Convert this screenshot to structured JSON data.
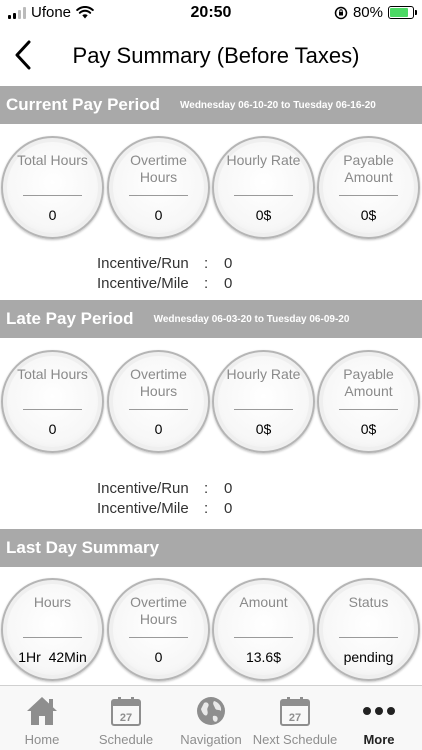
{
  "status_bar": {
    "carrier": "Ufone",
    "time": "20:50",
    "battery": "80%",
    "battery_level": 0.8
  },
  "header": {
    "title": "Pay Summary (Before Taxes)"
  },
  "current_period": {
    "title": "Current Pay Period",
    "dates": "Wednesday 06-10-20 to Tuesday 06-16-20",
    "cards": [
      {
        "label": "Total Hours",
        "value": "0"
      },
      {
        "label": "Overtime Hours",
        "value": "0"
      },
      {
        "label": "Hourly Rate",
        "value": "0$"
      },
      {
        "label": "Payable Amount",
        "value": "0$"
      }
    ],
    "incentive_run_label": "Incentive/Run",
    "incentive_run_value": "0",
    "incentive_mile_label": "Incentive/Mile",
    "incentive_mile_value": "0"
  },
  "late_period": {
    "title": "Late Pay Period",
    "dates": "Wednesday 06-03-20 to Tuesday 06-09-20",
    "cards": [
      {
        "label": "Total Hours",
        "value": "0"
      },
      {
        "label": "Overtime Hours",
        "value": "0"
      },
      {
        "label": "Hourly Rate",
        "value": "0$"
      },
      {
        "label": "Payable Amount",
        "value": "0$"
      }
    ],
    "incentive_run_label": "Incentive/Run",
    "incentive_run_value": "0",
    "incentive_mile_label": "Incentive/Mile",
    "incentive_mile_value": "0"
  },
  "last_day": {
    "title": "Last Day Summary",
    "cards": [
      {
        "label": "Hours",
        "value": "1Hr  42Min"
      },
      {
        "label": "Overtime Hours",
        "value": "0"
      },
      {
        "label": "Amount",
        "value": "13.6$"
      },
      {
        "label": "Status",
        "value": "pending"
      }
    ]
  },
  "tabs": [
    {
      "label": "Home",
      "icon": "home-icon"
    },
    {
      "label": "Schedule",
      "icon": "calendar-icon",
      "day": "27"
    },
    {
      "label": "Navigation",
      "icon": "globe-icon"
    },
    {
      "label": "Next Schedule",
      "icon": "calendar-icon",
      "day": "27"
    },
    {
      "label": "More",
      "icon": "more-icon",
      "active": true
    }
  ],
  "colors": {
    "section_bg": "#a9a9a9",
    "circle_label": "#8a8a8a",
    "tab_inactive": "#8e8e8e",
    "tab_active": "#222222"
  }
}
